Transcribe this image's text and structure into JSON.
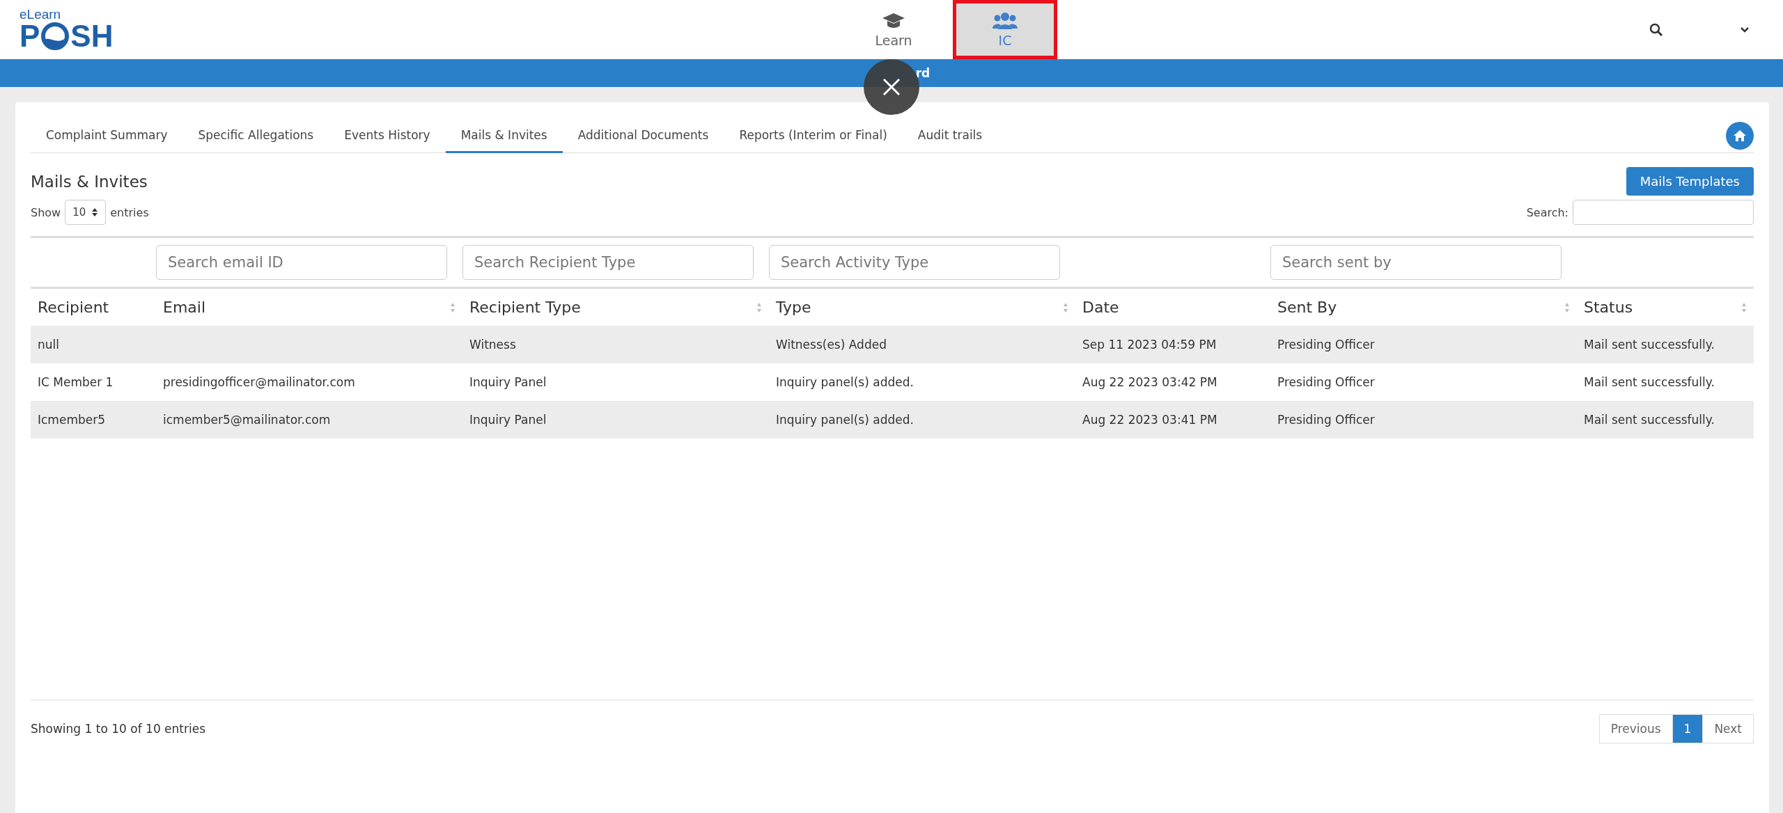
{
  "logo": {
    "top": "eLearn",
    "left": "P",
    "right": "SH"
  },
  "nav": [
    {
      "label": "Learn",
      "selected": false,
      "highlighted": false
    },
    {
      "label": "IC",
      "selected": true,
      "highlighted": true
    }
  ],
  "banner": {
    "title": "rd"
  },
  "tabs": [
    {
      "label": "Complaint Summary",
      "selected": false
    },
    {
      "label": "Specific Allegations",
      "selected": false
    },
    {
      "label": "Events History",
      "selected": false
    },
    {
      "label": "Mails & Invites",
      "selected": true
    },
    {
      "label": "Additional Documents",
      "selected": false
    },
    {
      "label": "Reports (Interim or Final)",
      "selected": false
    },
    {
      "label": "Audit trails",
      "selected": false
    }
  ],
  "section_title": "Mails & Invites",
  "templates_button": "Mails Templates",
  "length_menu": {
    "prefix": "Show",
    "value": "10",
    "suffix": "entries"
  },
  "search": {
    "label": "Search:"
  },
  "filters": [
    {
      "kind": "blank"
    },
    {
      "kind": "input",
      "placeholder": "Search email ID"
    },
    {
      "kind": "input",
      "placeholder": "Search Recipient Type"
    },
    {
      "kind": "input",
      "placeholder": "Search Activity Type"
    },
    {
      "kind": "blank"
    },
    {
      "kind": "input",
      "placeholder": "Search sent by"
    },
    {
      "kind": "blank"
    }
  ],
  "columns": [
    {
      "label": "Recipient",
      "sortable": false
    },
    {
      "label": "Email",
      "sortable": true
    },
    {
      "label": "Recipient Type",
      "sortable": true
    },
    {
      "label": "Type",
      "sortable": true
    },
    {
      "label": "Date",
      "sortable": false
    },
    {
      "label": "Sent By",
      "sortable": true
    },
    {
      "label": "Status",
      "sortable": true
    }
  ],
  "rows": [
    [
      "null",
      "",
      "Witness",
      "Witness(es) Added",
      "Sep 11 2023 04:59 PM",
      "Presiding Officer",
      "Mail sent successfully."
    ],
    [
      "IC Member 1",
      "presidingofficer@mailinator.com",
      "Inquiry Panel",
      "Inquiry panel(s) added.",
      "Aug 22 2023 03:42 PM",
      "Presiding Officer",
      "Mail sent successfully."
    ],
    [
      "Icmember5",
      "icmember5@mailinator.com",
      "Inquiry Panel",
      "Inquiry panel(s) added.",
      "Aug 22 2023 03:41 PM",
      "Presiding Officer",
      "Mail sent successfully."
    ]
  ],
  "info": "Showing 1 to 10 of 10 entries",
  "pagination": [
    {
      "label": "Previous",
      "selected": false
    },
    {
      "label": "1",
      "selected": true
    },
    {
      "label": "Next",
      "selected": false
    }
  ]
}
